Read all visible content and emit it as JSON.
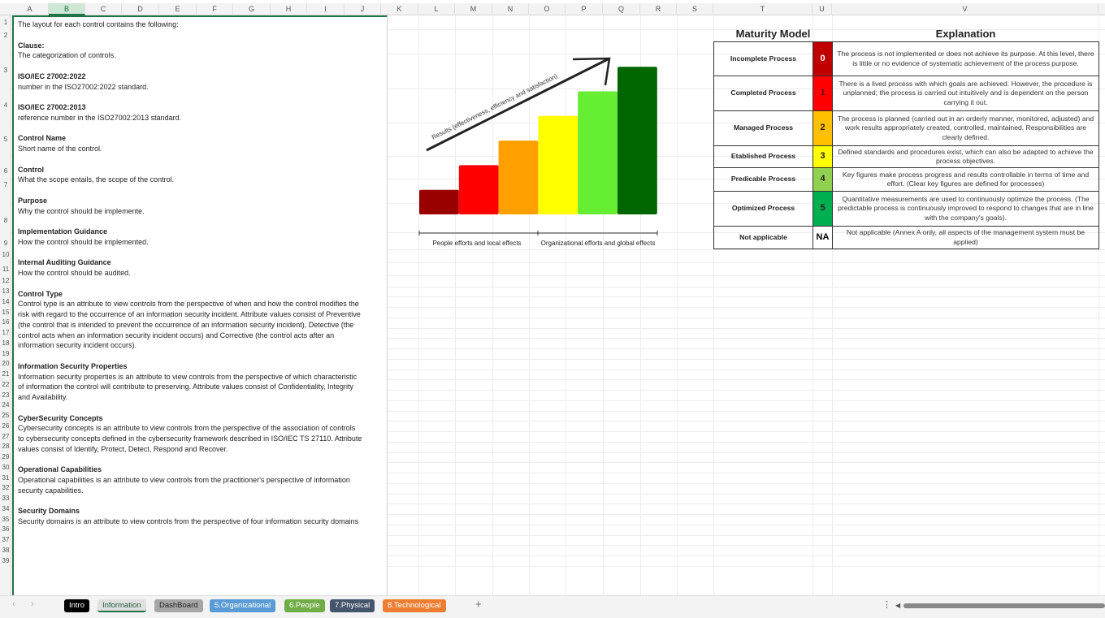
{
  "columns": [
    "A",
    "B",
    "C",
    "D",
    "E",
    "F",
    "G",
    "H",
    "I",
    "J",
    "K",
    "L",
    "M",
    "N",
    "O",
    "P",
    "Q",
    "R",
    "S",
    "T",
    "U",
    "V"
  ],
  "selected_column": "B",
  "rows": [
    "1",
    "2",
    "3",
    "4",
    "5",
    "6",
    "7",
    "8",
    "9",
    "10",
    "11",
    "12",
    "13",
    "14",
    "15",
    "16",
    "17",
    "18",
    "19",
    "20",
    "21",
    "22",
    "23",
    "24",
    "25",
    "26",
    "27",
    "28",
    "29",
    "30",
    "31",
    "32",
    "33",
    "34",
    "35",
    "36",
    "37",
    "38",
    "39"
  ],
  "intro_line": "The layout for each control contains the following:",
  "sections": [
    {
      "title": "Clause:",
      "body": "The categorization of controls."
    },
    {
      "title": "ISO/IEC 27002:2022",
      "body": "number in the ISO27002:2022 standard."
    },
    {
      "title": "ISO/IEC 27002:2013",
      "body": "reference number in the ISO27002:2013 standard."
    },
    {
      "title": "Control Name",
      "body": "Short name of the control."
    },
    {
      "title": "Control",
      "body": "What the scope entails, the scope of the control."
    },
    {
      "title": "Purpose",
      "body": "Why the control should be implemente."
    },
    {
      "title": "Implementation Guidance",
      "body": "How the control should be implemented."
    },
    {
      "title": "Internal Auditing Guidance",
      "body": "How the control should be audited."
    },
    {
      "title": "Control Type",
      "body": "Control type is an attribute to view controls from the perspective of when and how the control modifies the risk with regard to the occurrence of an information security incident. Attribute values consist of Preventive (the control that is intended to prevent the occurrence of an information security incident), Detective (the control acts when an information security incident occurs) and Corrective (the control acts after an information security incident occurs)."
    },
    {
      "title": "Information Security Properties",
      "body": "Information security properties is an attribute to view controls from the perspective of which characteristic of information the control will contribute to preserving. Attribute values consist of Confidentiality, Integrity and Availability."
    },
    {
      "title": "CyberSecurity Concepts",
      "body": "Cybersecurity concepts is an attribute to view controls from the perspective of the association of controls to cybersecurity concepts defined in the cybersecurity framework described in ISO/IEC TS 27110. Attribute values consist of Identify, Protect, Detect, Respond and Recover."
    },
    {
      "title": "Operational Capabilities",
      "body": "Operational capabilities is an attribute to view controls from the practitioner's perspective of information security capabilities."
    },
    {
      "title": "Security Domains",
      "body": "Security domains is an attribute to view controls from the perspective of four information security domains"
    }
  ],
  "figure": {
    "arrow_label": "Results (effectiveness, efficiency and satisfaction)",
    "left_label": "People efforts and local effects",
    "right_label": "Organizational efforts and global effects",
    "bar_colors": [
      "#990000",
      "#ff0000",
      "#ffa000",
      "#ffff00",
      "#66ee33",
      "#006600"
    ],
    "bar_levels": [
      1,
      2,
      3,
      4,
      5,
      6
    ]
  },
  "maturity": {
    "title": "Maturity Model",
    "explanation_header": "Explanation",
    "rows": [
      {
        "name": "Incomplete Process",
        "level": "0",
        "color": "#c00000",
        "text_color": "#ffffff",
        "explanation": "The process is not implemented or does not achieve its purpose. At this level, there is little or no evidence of systematic achievement of the process purpose."
      },
      {
        "name": "Completed Process",
        "level": "1",
        "color": "#ff0000",
        "text_color": "#660000",
        "explanation": "There is a lived process with which goals are achieved. However, the procedure is unplanned; the process is carried out intuitively and is dependent on the person carrying it out."
      },
      {
        "name": "Managed Process",
        "level": "2",
        "color": "#ffc000",
        "text_color": "#222222",
        "explanation": "The process is planned (carried out in an orderly manner, monitored, adjusted) and work results appropriately created, controlled, maintained. Responsibilities are clearly defined."
      },
      {
        "name": "Etablished Process",
        "level": "3",
        "color": "#ffff00",
        "text_color": "#222222",
        "explanation": "Defined standards and procedures exist, which can also be adapted to achieve the process objectives."
      },
      {
        "name": "Predicable Process",
        "level": "4",
        "color": "#92d050",
        "text_color": "#222222",
        "explanation": "Key figures make process progress and results controllable in terms of time and effort. (Clear key figures are defined for processes)"
      },
      {
        "name": "Optimized Process",
        "level": "5",
        "color": "#00b050",
        "text_color": "#222222",
        "explanation": "Quantitative measurements are used to continuously optimize the process. (The predictable process is continuously improved to respond to changes that are in line with the company's goals)."
      },
      {
        "name": "Not applicable",
        "level": "NA",
        "color": "#ffffff",
        "text_color": "#000000",
        "explanation": "Not applicable (Annex A only, all aspects of the management system must be applied)"
      }
    ]
  },
  "tabs": [
    {
      "label": "Intro",
      "bg": "#000000",
      "fg": "#ffffff"
    },
    {
      "label": "Information",
      "bg": "#e0e0e0",
      "fg": "#1f5c38",
      "active": true
    },
    {
      "label": "DashBoard",
      "bg": "#a6a6a6",
      "fg": "#222222"
    },
    {
      "label": "5.Organizational",
      "bg": "#5b9bd5",
      "fg": "#ffffff"
    },
    {
      "label": "6.People",
      "bg": "#70ad47",
      "fg": "#ffffff"
    },
    {
      "label": "7.Physical",
      "bg": "#44546a",
      "fg": "#ffffff"
    },
    {
      "label": "8.Technological",
      "bg": "#ed7d31",
      "fg": "#ffffff"
    }
  ],
  "add_sheet": "+",
  "prev": "‹",
  "next": "›",
  "more": "⋮"
}
